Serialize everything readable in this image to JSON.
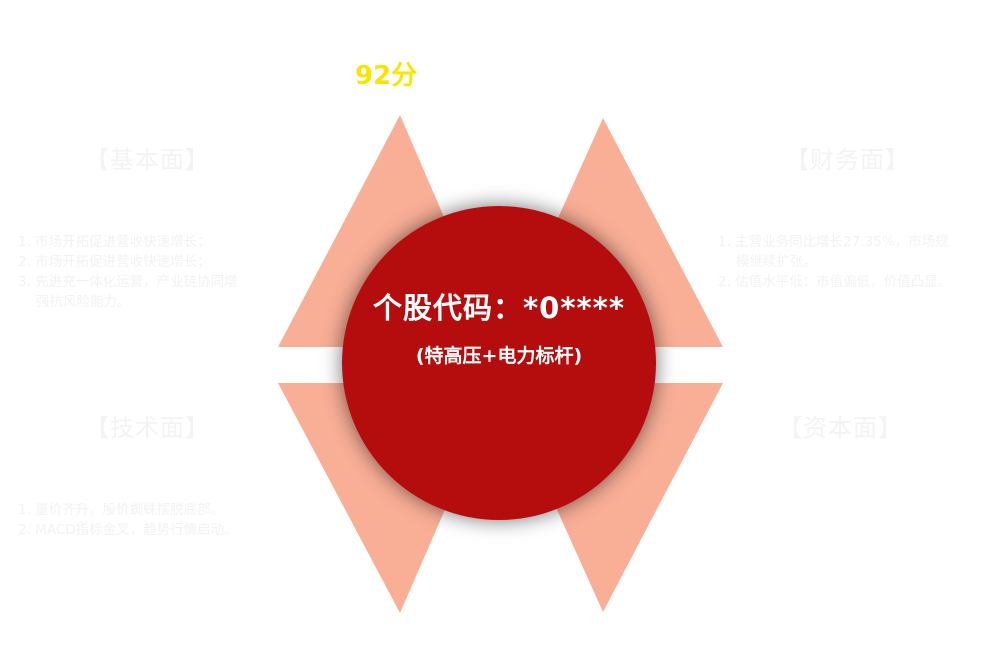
{
  "score": "92分",
  "center": {
    "code": "个股代码：*0****",
    "sector": "(特高压+电力标杆)"
  },
  "panels": {
    "fundamental": {
      "title": "【基本面】",
      "items": [
        "1. 市场开拓促进营收快速增长；",
        "2. 市场开拓促进营收快速增长；",
        "3. 先进充一体化运营，产业链协同增强抗风险能力。"
      ]
    },
    "financial": {
      "title": "【财务面】",
      "items": [
        "1. 主营业务同比增长27.35%，市场规模继续扩张。",
        "2. 估值水平低：市值偏低，价值凸显。"
      ]
    },
    "technical": {
      "title": "【技术面】",
      "items": [
        "1. 量价齐升，股价蜘蛛摆脱底部。",
        "2. MACD指标金叉，趋势行情启动。"
      ]
    },
    "capital": {
      "title": "【资本面】",
      "items": []
    }
  },
  "colors": {
    "circle": "#b50e10",
    "triangle": "#f9ae96",
    "score": "#f7e600"
  }
}
